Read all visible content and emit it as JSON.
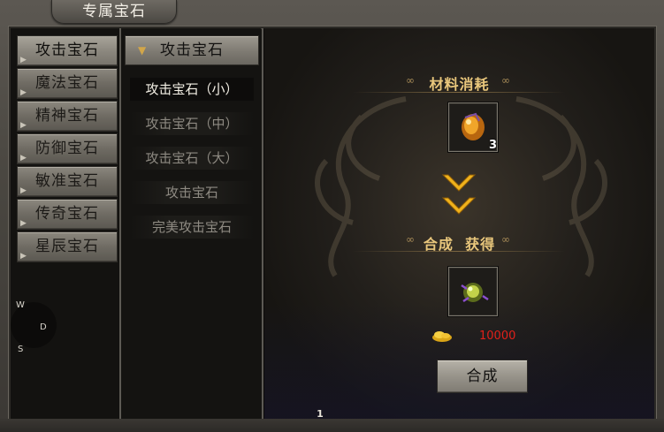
{
  "window": {
    "title": "专属宝石"
  },
  "categories": [
    {
      "label": "攻击宝石",
      "active": true
    },
    {
      "label": "魔法宝石"
    },
    {
      "label": "精神宝石"
    },
    {
      "label": "防御宝石"
    },
    {
      "label": "敏准宝石"
    },
    {
      "label": "传奇宝石"
    },
    {
      "label": "星辰宝石"
    }
  ],
  "compass": {
    "w": "W",
    "d": "D",
    "s": "S"
  },
  "sublist": {
    "header": "攻击宝石",
    "items": [
      {
        "label": "攻击宝石（小）",
        "active": true
      },
      {
        "label": "攻击宝石（中）"
      },
      {
        "label": "攻击宝石（大）"
      },
      {
        "label": "攻击宝石"
      },
      {
        "label": "完美攻击宝石"
      }
    ]
  },
  "detail": {
    "material_title": "材料消耗",
    "material_count": "3",
    "result_title": "合成  获得",
    "cost_value": "10000",
    "craft_label": "合成"
  },
  "colors": {
    "gold_text": "#e9c77c",
    "cost_red": "#e0201a"
  },
  "page": {
    "number": "1"
  }
}
